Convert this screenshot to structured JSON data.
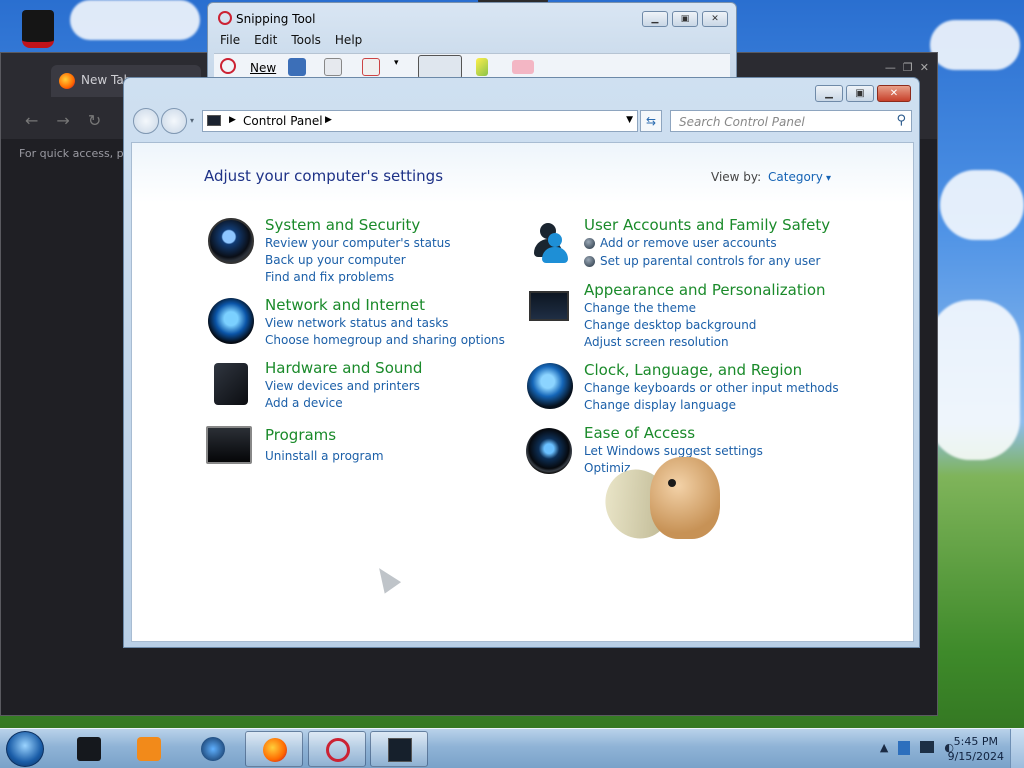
{
  "browser": {
    "tab_title": "New Tab",
    "hint_text": "For quick access, pl"
  },
  "snipping_tool": {
    "title": "Snipping Tool",
    "menu": [
      "File",
      "Edit",
      "Tools",
      "Help"
    ],
    "new_label": "New"
  },
  "control_panel": {
    "address": {
      "crumb": "Control Panel"
    },
    "search": {
      "placeholder": "Search Control Panel"
    },
    "heading": "Adjust your computer's settings",
    "view_by_label": "View by:",
    "view_by_value": "Category",
    "categories": [
      {
        "title": "System and Security",
        "icon": "shield-globe-icon",
        "links": [
          "Review your computer's status",
          "Back up your computer",
          "Find and fix problems"
        ]
      },
      {
        "title": "Network and Internet",
        "icon": "network-globe-icon",
        "links": [
          "View network status and tasks",
          "Choose homegroup and sharing options"
        ]
      },
      {
        "title": "Hardware and Sound",
        "icon": "printer-speaker-icon",
        "links": [
          "View devices and printers",
          "Add a device"
        ]
      },
      {
        "title": "Programs",
        "icon": "programs-icon",
        "links": [
          "Uninstall a program"
        ]
      },
      {
        "title": "User Accounts and Family Safety",
        "icon": "users-icon",
        "links": [
          "Add or remove user accounts",
          "Set up parental controls for any user"
        ]
      },
      {
        "title": "Appearance and Personalization",
        "icon": "monitor-icon",
        "links": [
          "Change the theme",
          "Change desktop background",
          "Adjust screen resolution"
        ]
      },
      {
        "title": "Clock, Language, and Region",
        "icon": "clock-globe-icon",
        "links": [
          "Change keyboards or other input methods",
          "Change display language"
        ]
      },
      {
        "title": "Ease of Access",
        "icon": "ease-of-access-icon",
        "links": [
          "Let Windows suggest settings",
          "Optimiz"
        ]
      }
    ]
  },
  "taskbar": {
    "time": "5:45 PM",
    "date": "9/15/2024",
    "colors": {
      "accent": "#1563b5",
      "category_title": "#1a8a2a",
      "link": "#1b5fa8"
    }
  }
}
